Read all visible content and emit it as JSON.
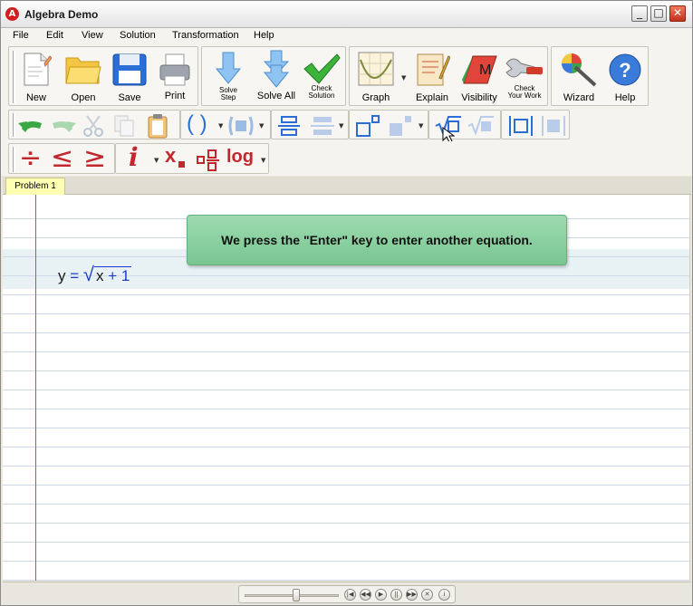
{
  "window": {
    "title": "Algebra Demo",
    "minimize_glyph": "_",
    "maximize_glyph": "□",
    "close_glyph": "✕",
    "icon_letter": "A"
  },
  "menu": [
    "File",
    "Edit",
    "View",
    "Solution",
    "Transformation",
    "Help"
  ],
  "toolbar1": {
    "new": "New",
    "open": "Open",
    "save": "Save",
    "print": "Print",
    "solve_step_1": "Solve",
    "solve_step_2": "Step",
    "solve_all": "Solve All",
    "check_solution_1": "Check",
    "check_solution_2": "Solution",
    "graph": "Graph",
    "explain": "Explain",
    "visibility": "Visibility",
    "visibility_letter": "M",
    "check_work_1": "Check",
    "check_work_2": "Your Work",
    "wizard": "Wizard",
    "help": "Help",
    "help_glyph": "?"
  },
  "toolbar3": {
    "info": "i",
    "subscript": "x",
    "log": "log",
    "divide": "÷",
    "le": "≤",
    "ge": "≥"
  },
  "tabs": [
    "Problem 1"
  ],
  "tooltip": "We press the \"Enter\" key to enter another equation.",
  "equation": {
    "lhs": "y",
    "eq": "=",
    "radical": "√",
    "x": "x",
    "plus": "+",
    "one": "1"
  },
  "colors": {
    "accent": "#1a3cc8",
    "margin": "#d8463c",
    "tooltip": "#86cc9a",
    "tab": "#ffffb4"
  }
}
